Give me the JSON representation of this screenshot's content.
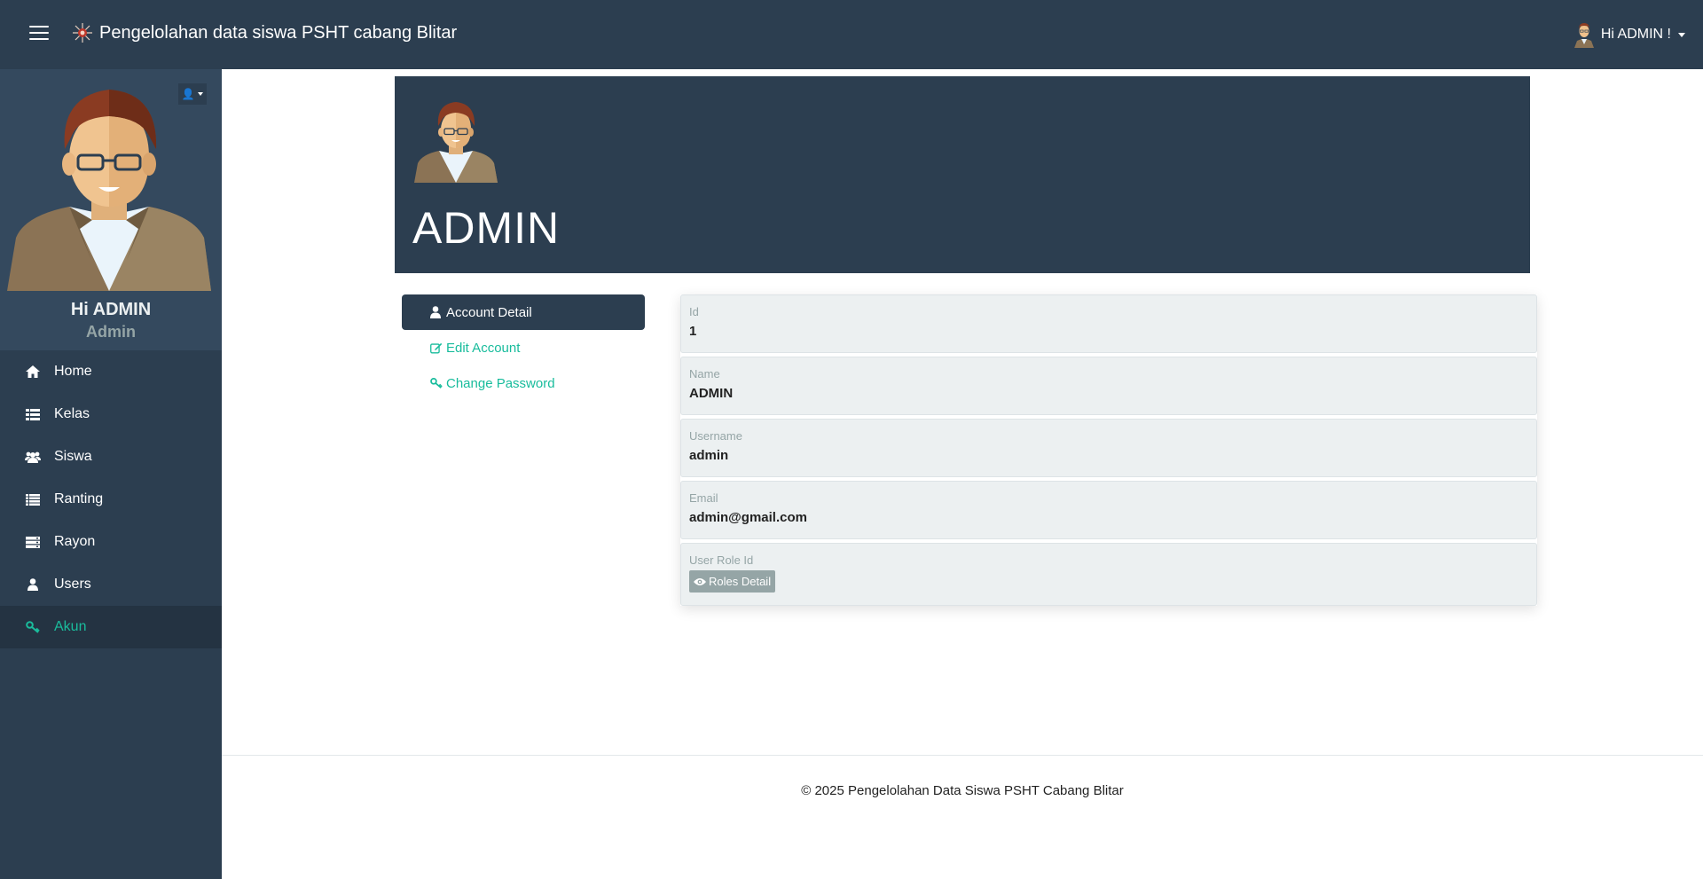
{
  "app": {
    "brand_title": "Pengelolahan data siswa PSHT cabang Blitar",
    "user_greeting": "Hi ADMIN !"
  },
  "sidebar": {
    "profile_name": "Hi ADMIN",
    "profile_role": "Admin",
    "items": [
      {
        "label": "Home",
        "icon": "home-icon"
      },
      {
        "label": "Kelas",
        "icon": "table-icon"
      },
      {
        "label": "Siswa",
        "icon": "users-icon"
      },
      {
        "label": "Ranting",
        "icon": "list-icon"
      },
      {
        "label": "Rayon",
        "icon": "server-icon"
      },
      {
        "label": "Users",
        "icon": "user-icon"
      },
      {
        "label": "Akun",
        "icon": "key-icon",
        "active": true
      }
    ]
  },
  "hero": {
    "title": "ADMIN"
  },
  "account_menu": {
    "detail": "Account Detail",
    "edit": "Edit Account",
    "password": "Change Password"
  },
  "details": {
    "id_label": "Id",
    "id_value": "1",
    "name_label": "Name",
    "name_value": "ADMIN",
    "username_label": "Username",
    "username_value": "admin",
    "email_label": "Email",
    "email_value": "admin@gmail.com",
    "role_label": "User Role Id",
    "roles_button": "Roles Detail"
  },
  "footer": {
    "text": "© 2025 Pengelolahan Data Siswa PSHT Cabang Blitar"
  },
  "colors": {
    "navbar": "#2c3e50",
    "accent": "#18bc9c",
    "field_bg": "#ecf0f1",
    "muted": "#95a5a6"
  }
}
